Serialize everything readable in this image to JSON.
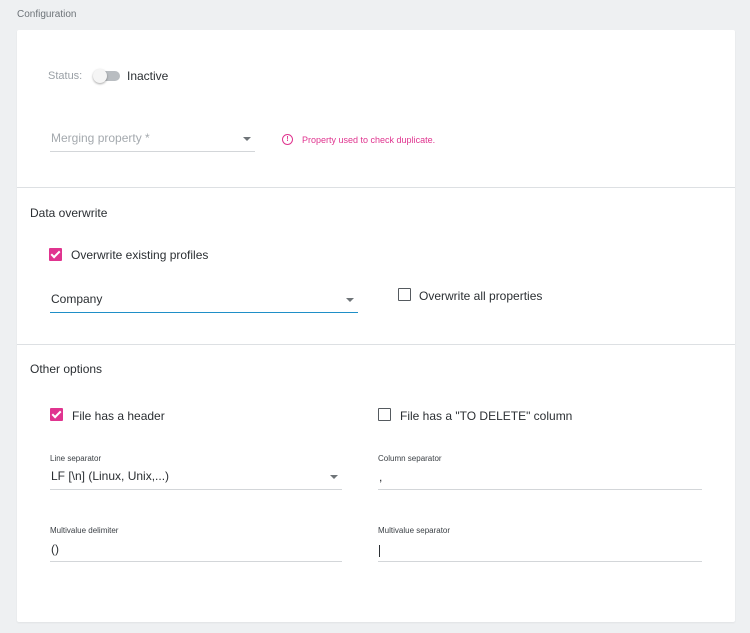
{
  "page": {
    "title": "Configuration"
  },
  "status": {
    "label": "Status:",
    "value": "Inactive",
    "enabled": false
  },
  "merging": {
    "placeholder": "Merging property *",
    "hint": "Property used to check duplicate.",
    "hint_icon": "info-circle-icon"
  },
  "data_overwrite": {
    "title": "Data overwrite",
    "overwrite_existing_label": "Overwrite existing profiles",
    "overwrite_existing_checked": true,
    "company_value": "Company",
    "overwrite_all_label": "Overwrite all properties",
    "overwrite_all_checked": false
  },
  "other_options": {
    "title": "Other options",
    "has_header_label": "File has a header",
    "has_header_checked": true,
    "to_delete_label": "File has a \"TO DELETE\" column",
    "to_delete_checked": false,
    "line_separator_label": "Line separator",
    "line_separator_value": "LF [\\n] (Linux, Unix,...)",
    "column_separator_label": "Column separator",
    "column_separator_value": ",",
    "multivalue_delimiter_label": "Multivalue delimiter",
    "multivalue_delimiter_value": "()",
    "multivalue_separator_label": "Multivalue separator",
    "multivalue_separator_value": ""
  },
  "colors": {
    "accent": "#e0348f",
    "focus": "#1f8fc7",
    "background": "#eef0f2"
  }
}
